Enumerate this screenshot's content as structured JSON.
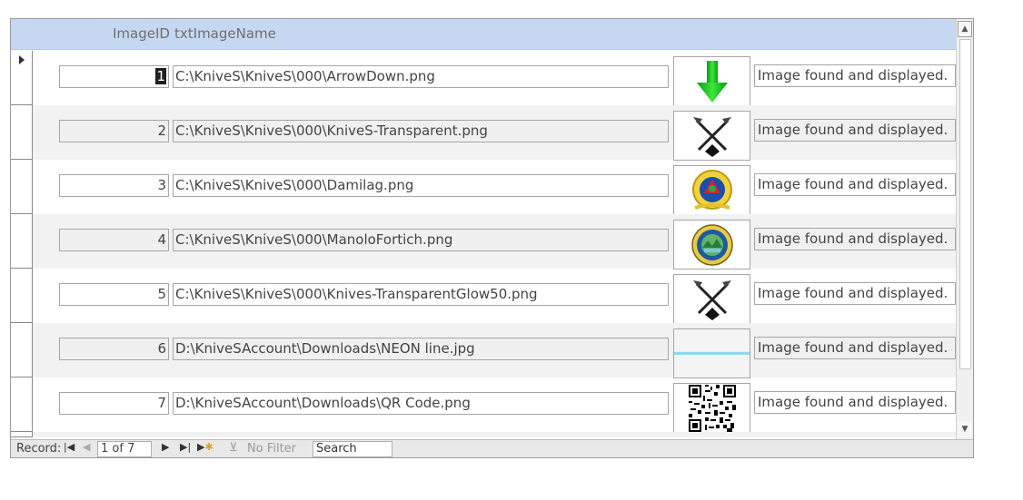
{
  "header": {
    "col_id": "ImageID",
    "col_name": "txtImageName"
  },
  "records": [
    {
      "id": "1",
      "path": "C:\\KniveS\\KniveS\\000\\ArrowDown.png",
      "status": "Image found and displayed.",
      "thumb": "green-arrow-down-icon"
    },
    {
      "id": "2",
      "path": "C:\\KniveS\\KniveS\\000\\KniveS-Transparent.png",
      "status": "Image found and displayed.",
      "thumb": "crossed-knives-icon"
    },
    {
      "id": "3",
      "path": "C:\\KniveS\\KniveS\\000\\Damilag.png",
      "status": "Image found and displayed.",
      "thumb": "damilag-seal-icon"
    },
    {
      "id": "4",
      "path": "C:\\KniveS\\KniveS\\000\\ManoloFortich.png",
      "status": "Image found and displayed.",
      "thumb": "manolo-fortich-seal-icon"
    },
    {
      "id": "5",
      "path": "C:\\KniveS\\KniveS\\000\\Knives-TransparentGlow50.png",
      "status": "Image found and displayed.",
      "thumb": "crossed-knives-glow-icon"
    },
    {
      "id": "6",
      "path": "D:\\KniveSAccount\\Downloads\\NEON line.jpg",
      "status": "Image found and displayed.",
      "thumb": "neon-line-icon"
    },
    {
      "id": "7",
      "path": "D:\\KniveSAccount\\Downloads\\QR Code.png",
      "status": "Image found and displayed.",
      "thumb": "qr-code-icon"
    }
  ],
  "nav": {
    "record_label": "Record:",
    "current": "1 of 7",
    "no_filter": "No Filter",
    "search": "Search"
  },
  "colors": {
    "header_bg": "#c5d7f1",
    "alt_row_bg": "#f2f2f2",
    "arrow_green": "#22c51e",
    "neon": "#8fd8ec"
  }
}
